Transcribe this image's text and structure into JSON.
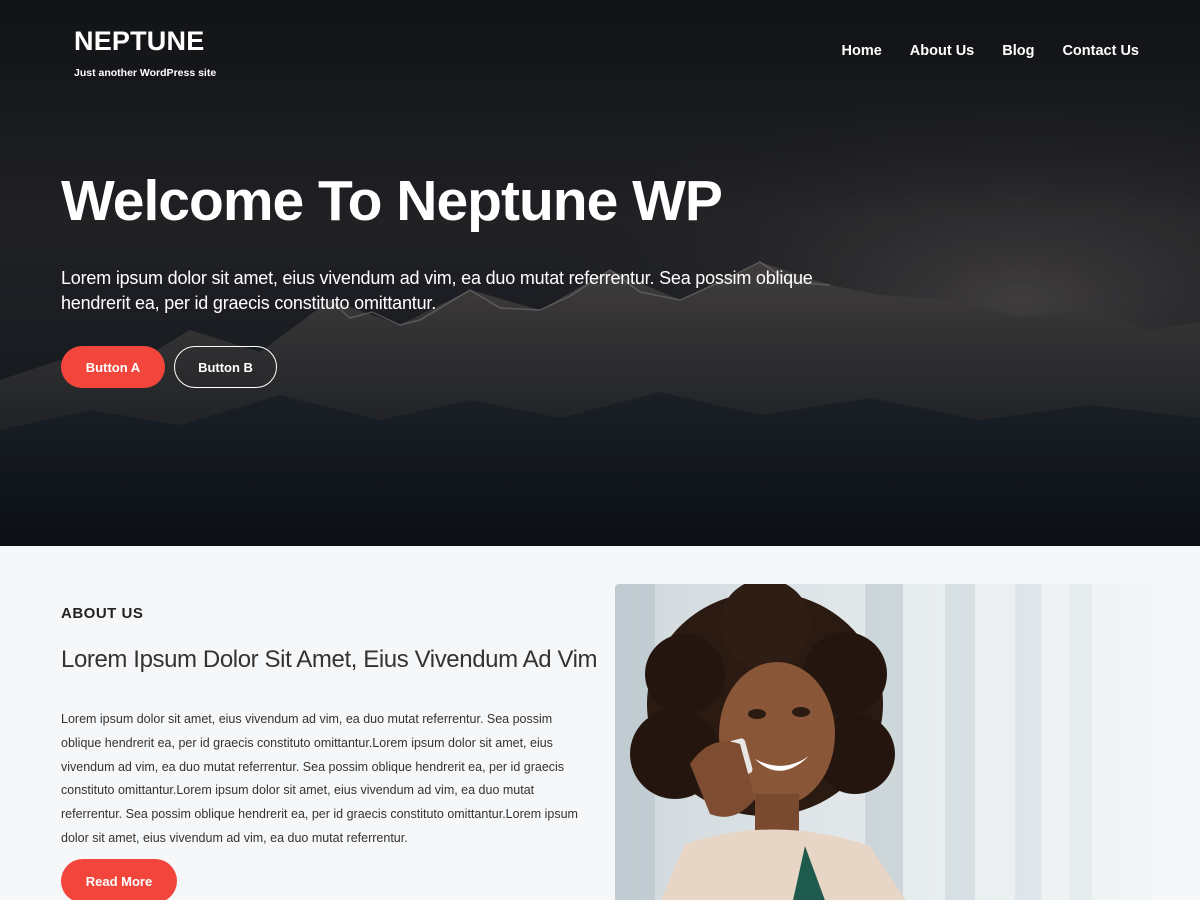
{
  "site": {
    "title": "NEPTUNE",
    "tagline": "Just another WordPress site"
  },
  "nav": {
    "items": [
      {
        "label": "Home"
      },
      {
        "label": "About Us"
      },
      {
        "label": "Blog"
      },
      {
        "label": "Contact Us"
      }
    ]
  },
  "hero": {
    "title": "Welcome To Neptune WP",
    "text": "Lorem ipsum dolor sit amet, eius vivendum ad vim, ea duo mutat referrentur. Sea possim oblique hendrerit ea, per id graecis constituto omittantur.",
    "button_a": "Button A",
    "button_b": "Button B",
    "background_image": "dark-mountain-range-photo"
  },
  "about": {
    "kicker": "ABOUT US",
    "heading": "Lorem Ipsum Dolor Sit Amet, Eius Vivendum Ad Vim",
    "body": "Lorem ipsum dolor sit amet, eius vivendum ad vim, ea duo mutat referrentur. Sea possim oblique hendrerit ea, per id graecis constituto omittantur.Lorem ipsum dolor sit amet, eius vivendum ad vim, ea duo mutat referrentur. Sea possim oblique hendrerit ea, per id graecis constituto omittantur.Lorem ipsum dolor sit amet, eius vivendum ad vim, ea duo mutat referrentur. Sea possim oblique hendrerit ea, per id graecis constituto omittantur.Lorem ipsum dolor sit amet, eius vivendum ad vim, ea duo mutat referrentur.",
    "button": "Read More",
    "image": "smiling-woman-on-phone-photo"
  },
  "colors": {
    "accent": "#f2463d",
    "section_bg": "#f5f7f9",
    "text_dark": "#333333"
  }
}
